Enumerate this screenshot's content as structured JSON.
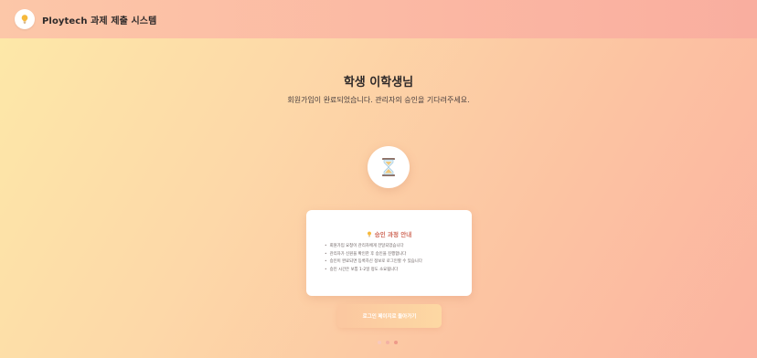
{
  "header": {
    "app_title": "Ploytech 과제 제출 시스템",
    "logo_icon": "lightbulb-icon"
  },
  "main": {
    "heading": "학생 이학생님",
    "subheading": "회원가입이 완료되었습니다. 관리자의 승인을 기다려주세요.",
    "status_icon": "hourglass-icon"
  },
  "info_card": {
    "title": "승인 과정 안내",
    "title_icon": "lightbulb-icon",
    "items": [
      "회원가입 요청이 관리자에게 전달되었습니다",
      "관리자가 신원을 확인한 후 승인을 진행합니다",
      "승인이 완료되면 등록하신 정보로 로그인할 수 있습니다",
      "승인 시간은 보통 1-2일 정도 소요됩니다"
    ]
  },
  "actions": {
    "back_to_login_label": "로그인 페이지로 돌아가기"
  },
  "colors": {
    "accent": "#d06a5a",
    "dot_1": "#f7c9bd",
    "dot_2": "#f3b1a3",
    "dot_3": "#ee9a89"
  }
}
